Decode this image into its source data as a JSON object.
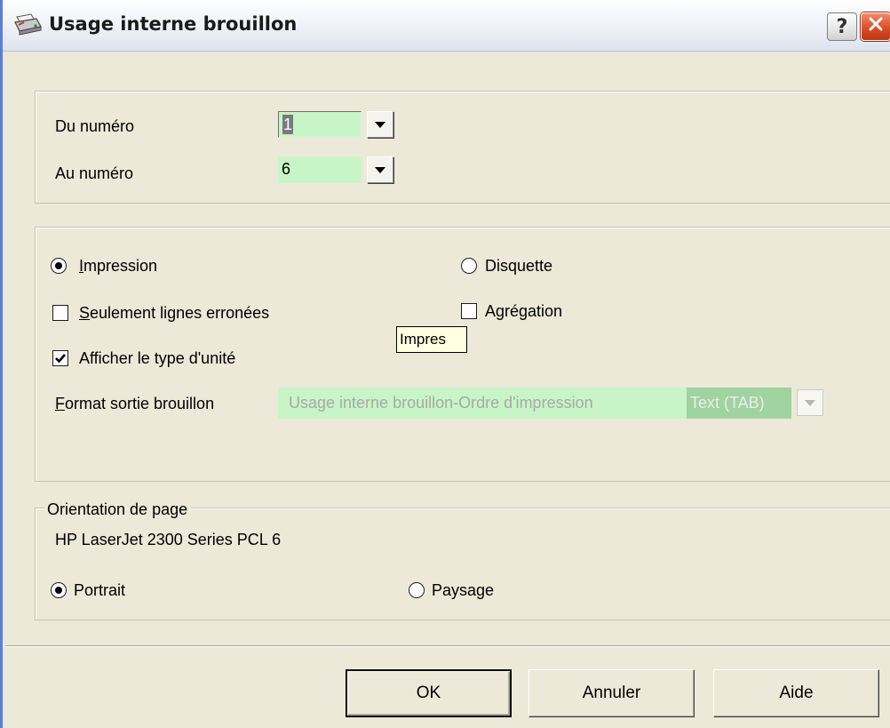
{
  "window": {
    "title": "Usage interne brouillon",
    "help_button": "?",
    "close_button": "×"
  },
  "range": {
    "from_label": "Du numéro",
    "from_value": "1",
    "to_label": "Au numéro",
    "to_value": "6"
  },
  "options": {
    "output": {
      "impression_label": "Impression",
      "impression_mnemonic": "I",
      "impression_rest": "mpression",
      "impression_selected": true,
      "disquette_label": "Disquette",
      "disquette_selected": false
    },
    "erroneous_lines": {
      "label": "Seulement lignes erronées",
      "mnemonic": "S",
      "rest": "eulement lignes erronées",
      "checked": false
    },
    "aggregation": {
      "label": "Agrégation",
      "checked": false
    },
    "show_unit_type": {
      "label": "Afficher le type d'unité",
      "checked": true
    },
    "format": {
      "label": "Format sortie brouillon",
      "mnemonic": "F",
      "rest": "ormat sortie brouillon",
      "value": "Usage  interne  brouillon-Ordre  d'impression",
      "type": "Text (TAB)",
      "disabled": true
    }
  },
  "tooltip": {
    "text": "Impres"
  },
  "orientation": {
    "legend": "Orientation de page",
    "printer": "HP LaserJet 2300 Series PCL 6",
    "portrait_label": "Portrait",
    "portrait_selected": true,
    "landscape_label": "Paysage",
    "landscape_selected": false
  },
  "buttons": {
    "ok": "OK",
    "cancel": "Annuler",
    "help": "Aide"
  },
  "colors": {
    "field_green": "#c7f5c7",
    "dialog_bg": "#ece9d8",
    "close_red": "#d84a22",
    "tooltip_bg": "#ffffe1"
  },
  "icons": {
    "title": "printer-icon",
    "check": "checkmark-icon",
    "dropdown": "chevron-down-icon"
  }
}
